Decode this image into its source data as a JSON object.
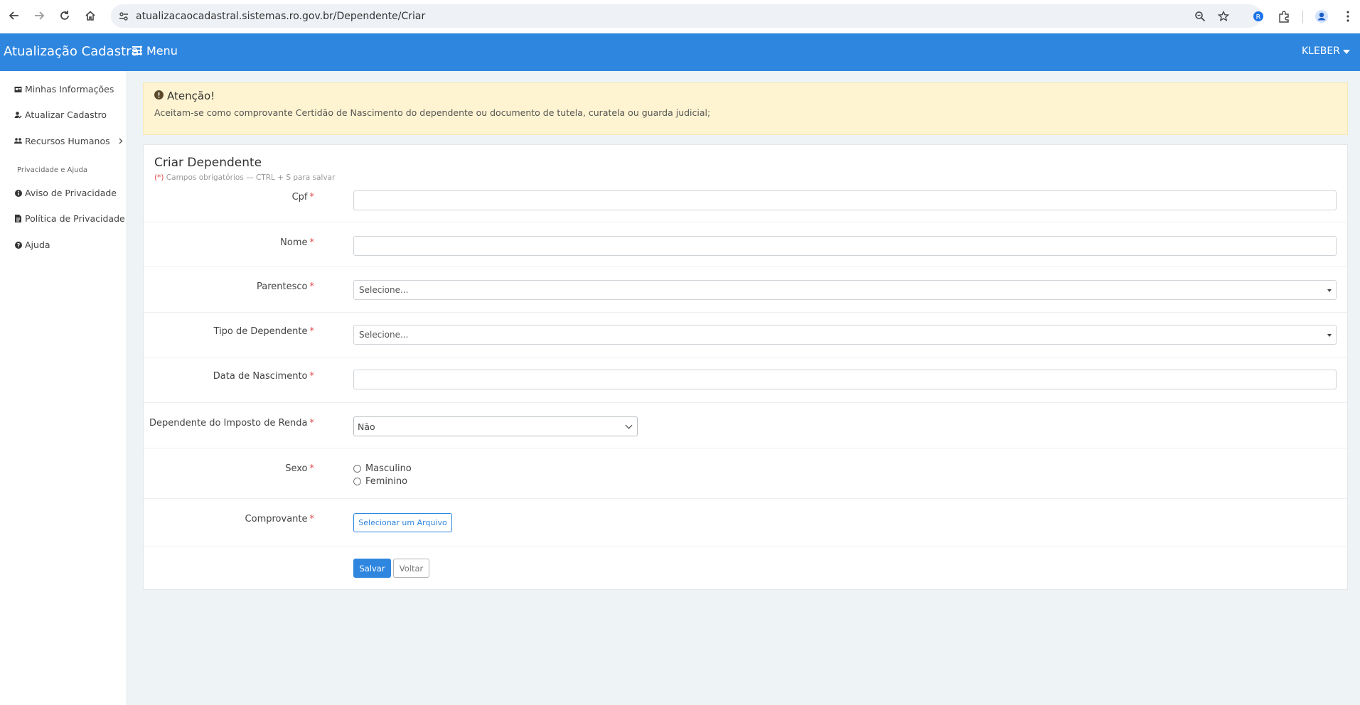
{
  "browser": {
    "url": "atualizacaocadastral.sistemas.ro.gov.br/Dependente/Criar",
    "icons": [
      "back-icon",
      "forward-icon",
      "reload-icon",
      "home-icon",
      "site-settings-icon",
      "zoom-icon",
      "bookmark-star-icon",
      "extension-badge-icon",
      "extensions-puzzle-icon",
      "profile-icon",
      "more-icon"
    ]
  },
  "header": {
    "brand": "Atualização Cadastral",
    "menu_label": "Menu",
    "user": "KLEBER",
    "bg_color": "#2f86df"
  },
  "sidebar": {
    "items": [
      {
        "label": "Minhas Informações",
        "icon": "id-card-icon"
      },
      {
        "label": "Atualizar Cadastro",
        "icon": "user-edit-icon"
      },
      {
        "label": "Recursos Humanos",
        "icon": "users-icon"
      }
    ],
    "section_title": "Privacidade e Ajuda",
    "privacy_items": [
      {
        "label": "Aviso de Privacidade",
        "icon": "info-circle-icon"
      },
      {
        "label": "Política de Privacidade",
        "icon": "document-icon"
      },
      {
        "label": "Ajuda",
        "icon": "question-circle-icon"
      }
    ]
  },
  "alert": {
    "title": "Atenção!",
    "body": "Aceitam-se como comprovante Certidão de Nascimento do dependente ou documento de tutela, curatela ou guarda judicial;",
    "bg_color": "#fff4d1"
  },
  "form": {
    "title": "Criar Dependente",
    "required_marker": "(*)",
    "subtitle": "Campos obrigatórios — CTRL + S para salvar",
    "fields": {
      "cpf": {
        "label": "Cpf",
        "value": ""
      },
      "nome": {
        "label": "Nome",
        "value": ""
      },
      "parentesco": {
        "label": "Parentesco",
        "value": "Selecione..."
      },
      "tipo": {
        "label": "Tipo de Dependente",
        "value": "Selecione..."
      },
      "nascimento": {
        "label": "Data de Nascimento",
        "value": ""
      },
      "imposto": {
        "label": "Dependente do Imposto de Renda",
        "value": "Não"
      },
      "sexo": {
        "label": "Sexo",
        "options": [
          "Masculino",
          "Feminino"
        ]
      },
      "comprovante": {
        "label": "Comprovante",
        "button": "Selecionar um Arquivo"
      }
    },
    "required_star": "*",
    "save_label": "Salvar",
    "back_label": "Voltar"
  }
}
